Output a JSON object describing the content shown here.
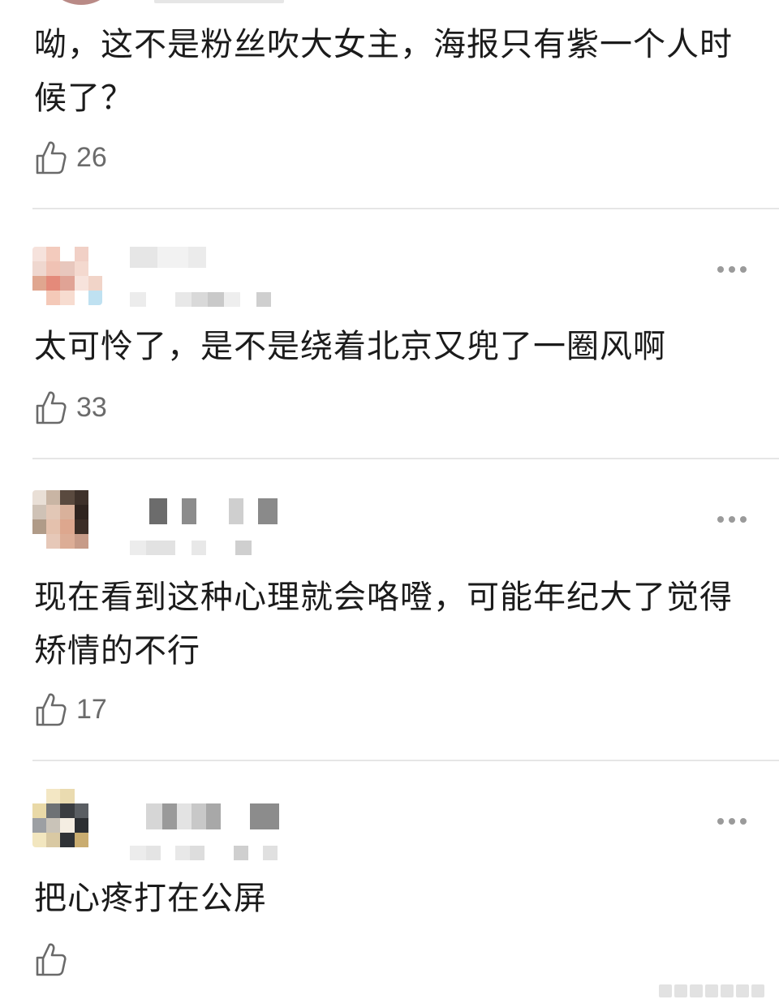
{
  "comments": [
    {
      "text": "呦，这不是粉丝吹大女主，海报只有紫一个人时候了？",
      "likes": "26"
    },
    {
      "text": "太可怜了，是不是绕着北京又兜了一圈风啊",
      "likes": "33"
    },
    {
      "text": "现在看到这种心理就会咯噔，可能年纪大了觉得矫情的不行",
      "likes": "17"
    },
    {
      "text": "把心疼打在公屏",
      "likes": ""
    }
  ],
  "icons": {
    "like": "thumbs-up-icon",
    "more": "more-dots-icon"
  },
  "colors": {
    "text": "#1b1b1b",
    "meta": "#6b6b6b",
    "divider": "#e6e6e6",
    "icon": "#6a6a6a"
  }
}
